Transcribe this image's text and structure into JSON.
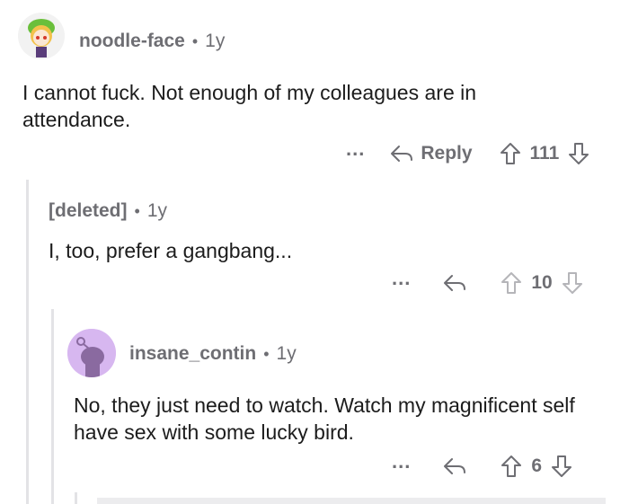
{
  "comments": [
    {
      "username": "noodle-face",
      "age": "1y",
      "body": "I cannot fuck. Not enough of my colleagues are in attendance.",
      "more": "...",
      "reply_label": "Reply",
      "votes": "111"
    },
    {
      "username": "[deleted]",
      "age": "1y",
      "body": "I, too, prefer a gangbang...",
      "more": "...",
      "votes": "10"
    },
    {
      "username": "insane_contin",
      "age": "1y",
      "body": "No, they just need to watch. Watch my magnificent self have sex with some lucky bird.",
      "more": "...",
      "votes": "6"
    }
  ],
  "separator": "•",
  "icons": {
    "avatar1": "anime-avatar-icon",
    "avatar3": "snoo-avatar-icon",
    "reply": "reply-arrow-icon",
    "upvote": "upvote-icon",
    "downvote": "downvote-icon"
  },
  "colors": {
    "avatar3_bg": "#d7b7f0",
    "thread_line": "#e3e3e6",
    "meta_gray": "#6e6e73"
  }
}
